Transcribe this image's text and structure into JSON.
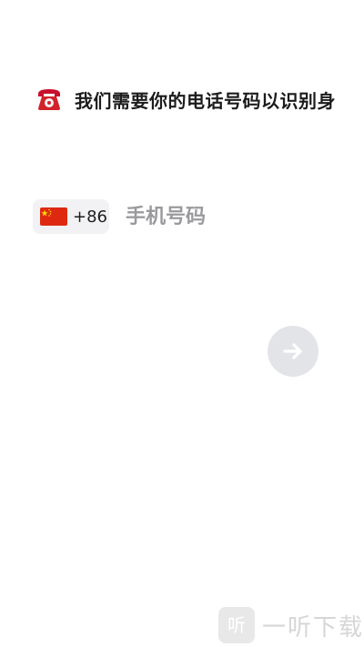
{
  "header": {
    "title": "我们需要你的电话号码以识别身",
    "icon": "telephone-icon"
  },
  "phone": {
    "country_flag": "china-flag-icon",
    "dial_code": "+86",
    "placeholder": "手机号码",
    "value": ""
  },
  "next_button": {
    "icon": "arrow-right-icon",
    "color": "#e3e4e8"
  },
  "watermark": {
    "logo_text": "听",
    "text": "一听下载"
  },
  "colors": {
    "background": "#ffffff",
    "flag_red": "#de2910",
    "flag_yellow": "#ffde00",
    "button_bg": "#e3e4e8"
  }
}
